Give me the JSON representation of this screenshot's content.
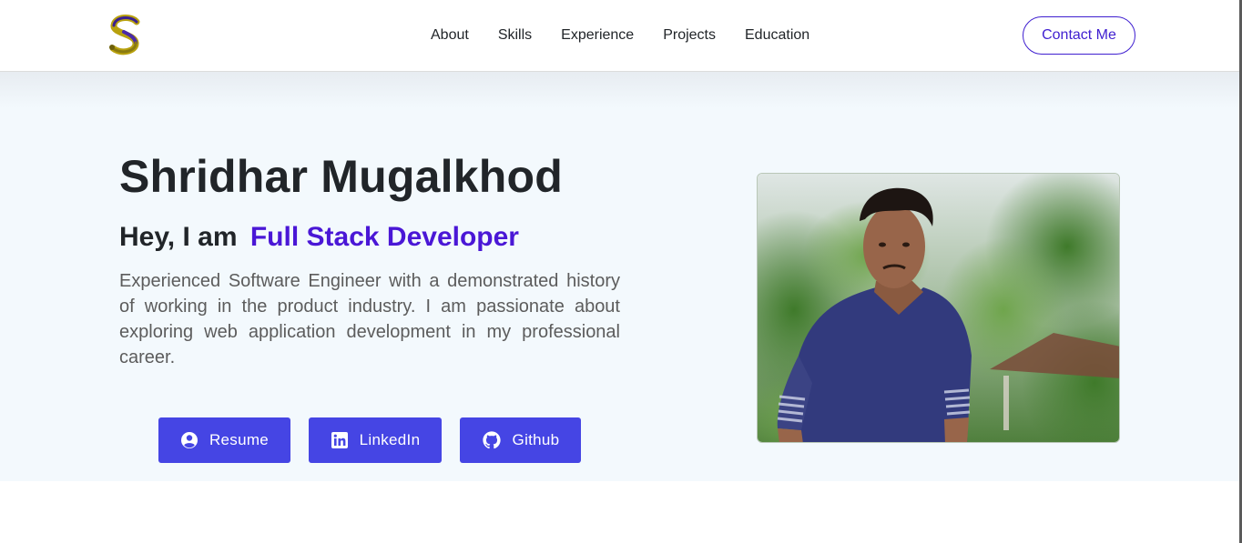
{
  "nav": {
    "logo_alt": "S",
    "links": [
      "About",
      "Skills",
      "Experience",
      "Projects",
      "Education"
    ],
    "contact_label": "Contact Me"
  },
  "hero": {
    "name": "Shridhar Mugalkhod",
    "greeting": "Hey, I am",
    "role": "Full Stack Developer",
    "about": "Experienced Software Engineer with a demonstrated history of working in the product industry. I am passionate about exploring web application development in my professional career.",
    "buttons": {
      "resume": "Resume",
      "linkedin": "LinkedIn",
      "github": "Github"
    }
  },
  "icons": {
    "resume": "user-circle-icon",
    "linkedin": "linkedin-icon",
    "github": "github-icon"
  },
  "colors": {
    "accent": "#4a17d6",
    "button": "#4545e4",
    "hero_bg": "#f3f9fd"
  }
}
